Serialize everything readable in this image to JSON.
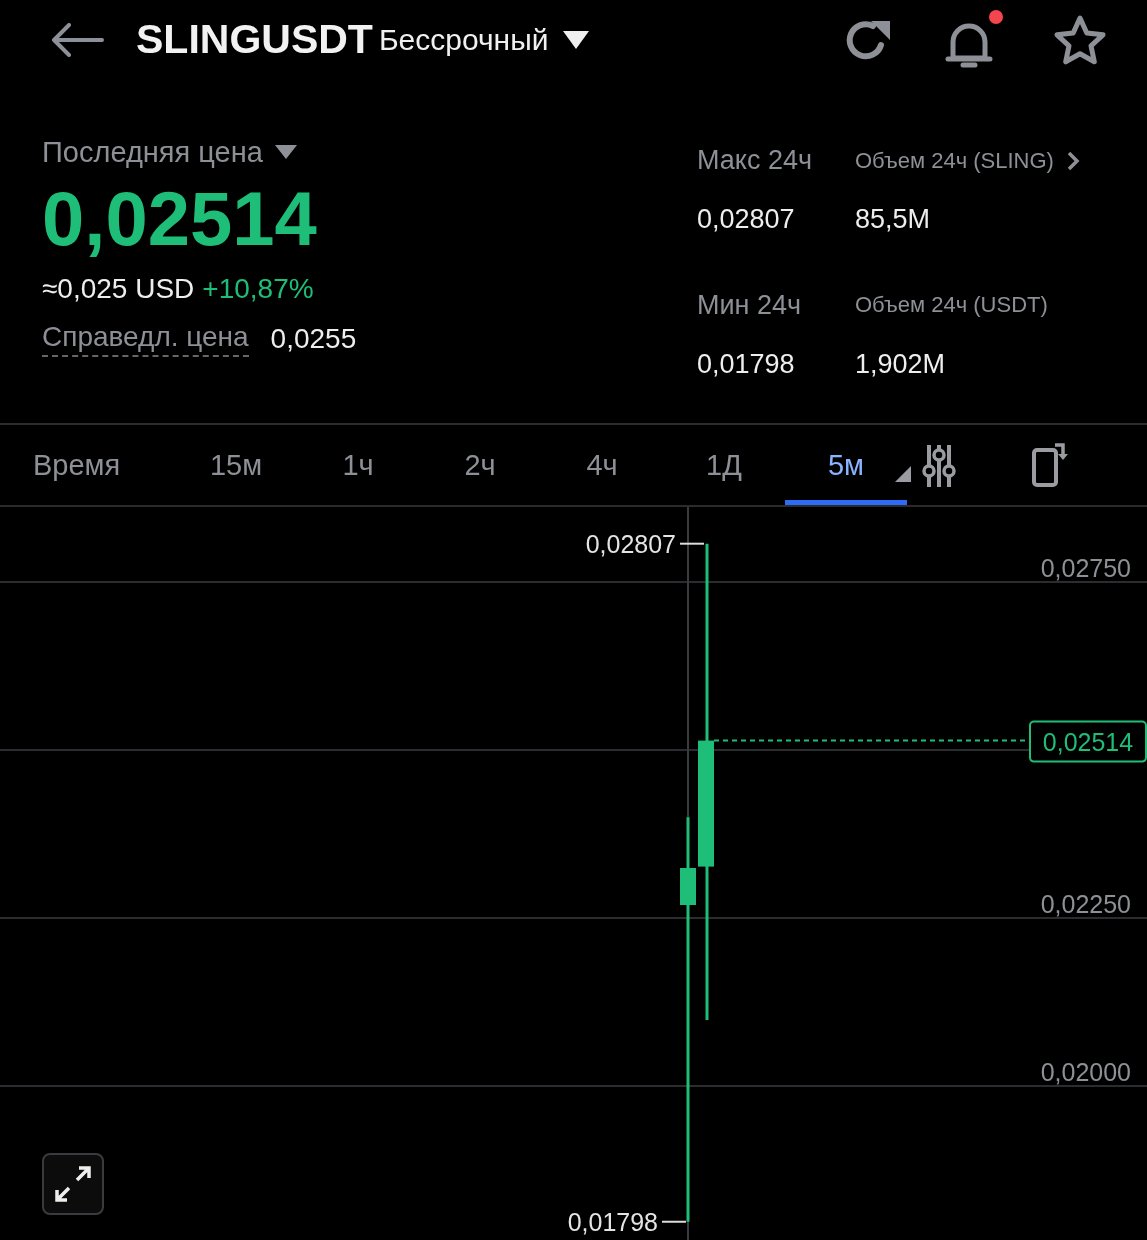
{
  "header": {
    "symbol": "SLINGUSDT",
    "contract_type": "Бессрочный",
    "notification_dot": true
  },
  "price_panel": {
    "label": "Последняя цена",
    "last_price": "0,02514",
    "usd_value": "≈0,025 USD",
    "change": "+10,87%",
    "fair_label": "Справедл. цена",
    "fair_price": "0,0255"
  },
  "stats": [
    {
      "label": "Макс 24ч",
      "value": "0,02807",
      "link": false
    },
    {
      "label": "Объем 24ч (SLING)",
      "value": "85,5M",
      "link": true
    },
    {
      "label": "Мин 24ч",
      "value": "0,01798",
      "link": false
    },
    {
      "label": "Объем 24ч  (USDT)",
      "value": "1,902M",
      "link": false
    }
  ],
  "intervals": {
    "label": "Время",
    "tabs": [
      {
        "label": "15м",
        "selected": false,
        "menu": false
      },
      {
        "label": "1ч",
        "selected": false,
        "menu": false
      },
      {
        "label": "2ч",
        "selected": false,
        "menu": false
      },
      {
        "label": "4ч",
        "selected": false,
        "menu": false
      },
      {
        "label": "1Д",
        "selected": false,
        "menu": false
      },
      {
        "label": "5м",
        "selected": true,
        "menu": true
      }
    ]
  },
  "chart": {
    "high_label": "0,02807",
    "low_label": "0,01798",
    "current_price": "0,02514",
    "axis_labels": [
      "0,02750",
      "0,02250",
      "0,02000"
    ]
  }
}
